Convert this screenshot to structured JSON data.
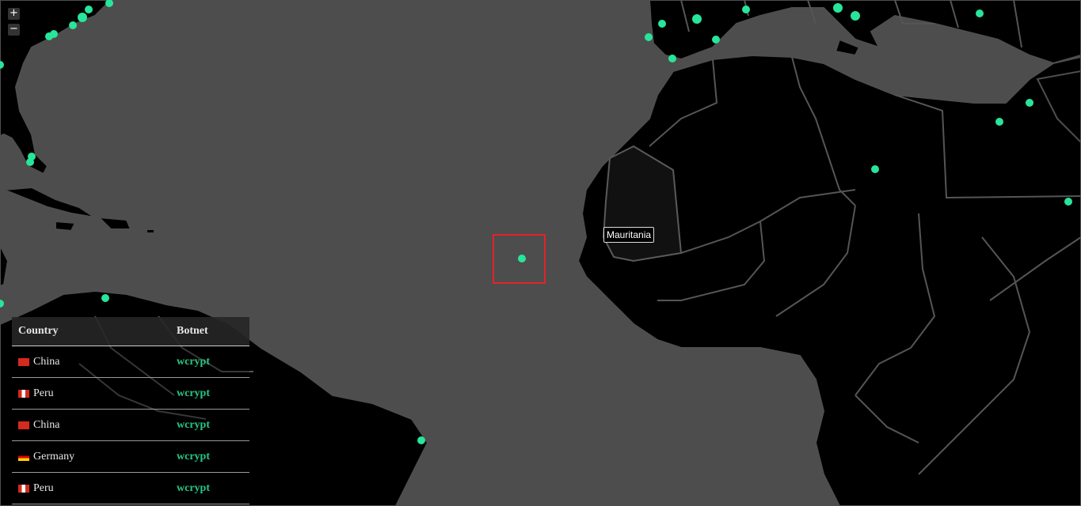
{
  "controls": {
    "zoom_in": "+",
    "zoom_out": "−"
  },
  "tooltip": {
    "country": "Mauritania"
  },
  "table": {
    "headers": {
      "country": "Country",
      "botnet": "Botnet"
    },
    "rows": [
      {
        "country": "China",
        "flag": "china-flag-icon",
        "botnet": "wcrypt"
      },
      {
        "country": "Peru",
        "flag": "peru-flag-icon",
        "botnet": "wcrypt"
      },
      {
        "country": "China",
        "flag": "china-flag-icon",
        "botnet": "wcrypt"
      },
      {
        "country": "Germany",
        "flag": "germany-flag-icon",
        "botnet": "wcrypt"
      },
      {
        "country": "Peru",
        "flag": "peru-flag-icon",
        "botnet": "wcrypt"
      }
    ]
  },
  "colors": {
    "ocean": "#4d4d4d",
    "land": "#000000",
    "marker": "#28e59a",
    "botnet_text": "#28c684",
    "selection": "#e0242a"
  }
}
